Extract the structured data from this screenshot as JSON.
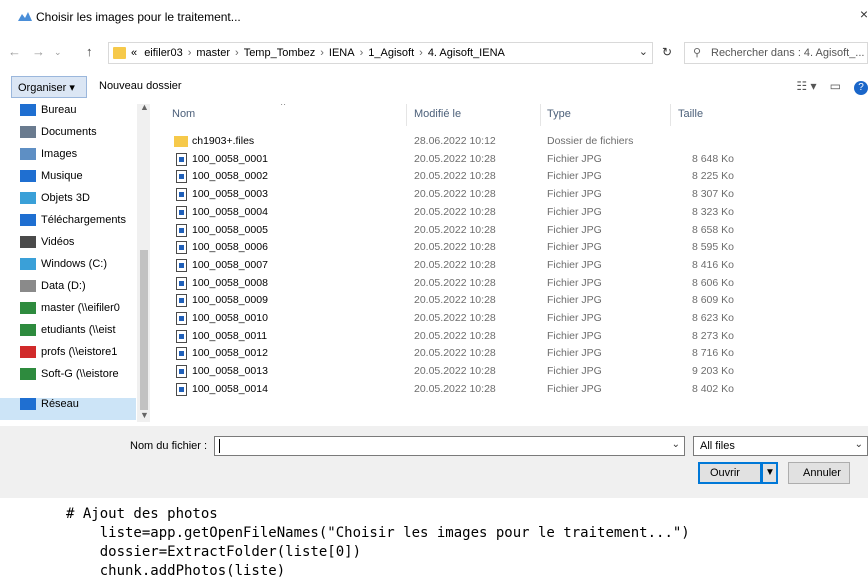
{
  "window": {
    "title": "Choisir les images pour le traitement...",
    "close_glyph": "×"
  },
  "address": {
    "crumbs": [
      "eifiler03",
      "master",
      "Temp_Tombez",
      "IENA",
      "1_Agisoft",
      "4. Agisoft_IENA"
    ],
    "overflow": "«",
    "search_placeholder": "Rechercher dans : 4. Agisoft_..."
  },
  "toolbar": {
    "organize_label": "Organiser ▾",
    "new_folder_label": "Nouveau dossier"
  },
  "nav": {
    "items": [
      {
        "label": "Bureau",
        "icon": "desktop-icon",
        "color": "#1f6fd1"
      },
      {
        "label": "Documents",
        "icon": "documents-icon",
        "color": "#6a7b8f"
      },
      {
        "label": "Images",
        "icon": "pictures-icon",
        "color": "#5e8fc4"
      },
      {
        "label": "Musique",
        "icon": "music-icon",
        "color": "#1f6fd1"
      },
      {
        "label": "Objets 3D",
        "icon": "objects3d-icon",
        "color": "#3aa0d8"
      },
      {
        "label": "Téléchargements",
        "icon": "downloads-icon",
        "color": "#1f6fd1"
      },
      {
        "label": "Vidéos",
        "icon": "videos-icon",
        "color": "#4a4a4a"
      },
      {
        "label": "Windows (C:)",
        "icon": "drive-c-icon",
        "color": "#3aa0d8"
      },
      {
        "label": "Data (D:)",
        "icon": "drive-d-icon",
        "color": "#8a8a8a"
      },
      {
        "label": "master (\\\\eifiler0",
        "icon": "network-drive-icon",
        "color": "#2e8b3e"
      },
      {
        "label": "etudiants (\\\\eist",
        "icon": "network-drive-icon",
        "color": "#2e8b3e"
      },
      {
        "label": "profs (\\\\eistore1",
        "icon": "disconnected-drive-icon",
        "color": "#d12a2a"
      },
      {
        "label": "Soft-G (\\\\eistore",
        "icon": "network-drive-icon",
        "color": "#2e8b3e"
      },
      {
        "label": "Réseau",
        "icon": "network-icon",
        "color": "#1f6fd1"
      }
    ]
  },
  "list": {
    "headers": {
      "name": "Nom",
      "date": "Modifié le",
      "type": "Type",
      "size": "Taille"
    },
    "rows": [
      {
        "name": "ch1903+.files",
        "date": "28.06.2022 10:12",
        "type": "Dossier de fichiers",
        "size": "",
        "kind": "folder"
      },
      {
        "name": "100_0058_0001",
        "date": "20.05.2022 10:28",
        "type": "Fichier JPG",
        "size": "8 648 Ko",
        "kind": "jpg"
      },
      {
        "name": "100_0058_0002",
        "date": "20.05.2022 10:28",
        "type": "Fichier JPG",
        "size": "8 225 Ko",
        "kind": "jpg"
      },
      {
        "name": "100_0058_0003",
        "date": "20.05.2022 10:28",
        "type": "Fichier JPG",
        "size": "8 307 Ko",
        "kind": "jpg"
      },
      {
        "name": "100_0058_0004",
        "date": "20.05.2022 10:28",
        "type": "Fichier JPG",
        "size": "8 323 Ko",
        "kind": "jpg"
      },
      {
        "name": "100_0058_0005",
        "date": "20.05.2022 10:28",
        "type": "Fichier JPG",
        "size": "8 658 Ko",
        "kind": "jpg"
      },
      {
        "name": "100_0058_0006",
        "date": "20.05.2022 10:28",
        "type": "Fichier JPG",
        "size": "8 595 Ko",
        "kind": "jpg"
      },
      {
        "name": "100_0058_0007",
        "date": "20.05.2022 10:28",
        "type": "Fichier JPG",
        "size": "8 416 Ko",
        "kind": "jpg"
      },
      {
        "name": "100_0058_0008",
        "date": "20.05.2022 10:28",
        "type": "Fichier JPG",
        "size": "8 606 Ko",
        "kind": "jpg"
      },
      {
        "name": "100_0058_0009",
        "date": "20.05.2022 10:28",
        "type": "Fichier JPG",
        "size": "8 609 Ko",
        "kind": "jpg"
      },
      {
        "name": "100_0058_0010",
        "date": "20.05.2022 10:28",
        "type": "Fichier JPG",
        "size": "8 623 Ko",
        "kind": "jpg"
      },
      {
        "name": "100_0058_0011",
        "date": "20.05.2022 10:28",
        "type": "Fichier JPG",
        "size": "8 273 Ko",
        "kind": "jpg"
      },
      {
        "name": "100_0058_0012",
        "date": "20.05.2022 10:28",
        "type": "Fichier JPG",
        "size": "8 716 Ko",
        "kind": "jpg"
      },
      {
        "name": "100_0058_0013",
        "date": "20.05.2022 10:28",
        "type": "Fichier JPG",
        "size": "9 203 Ko",
        "kind": "jpg"
      },
      {
        "name": "100_0058_0014",
        "date": "20.05.2022 10:28",
        "type": "Fichier JPG",
        "size": "8 402 Ko",
        "kind": "jpg"
      }
    ]
  },
  "footer": {
    "filename_label": "Nom du fichier :",
    "filename_value": "",
    "filter_value": "All files",
    "open_label": "Ouvrir",
    "cancel_label": "Annuler"
  },
  "code": {
    "lines": [
      "# Ajout des photos",
      "    liste=app.getOpenFileNames(\"Choisir les images pour le traitement...\")",
      "    dossier=ExtractFolder(liste[0])",
      "    chunk.addPhotos(liste)"
    ]
  },
  "colors": {
    "accent": "#0078d7",
    "selection": "#cce4f7",
    "folder": "#f6c94a"
  }
}
